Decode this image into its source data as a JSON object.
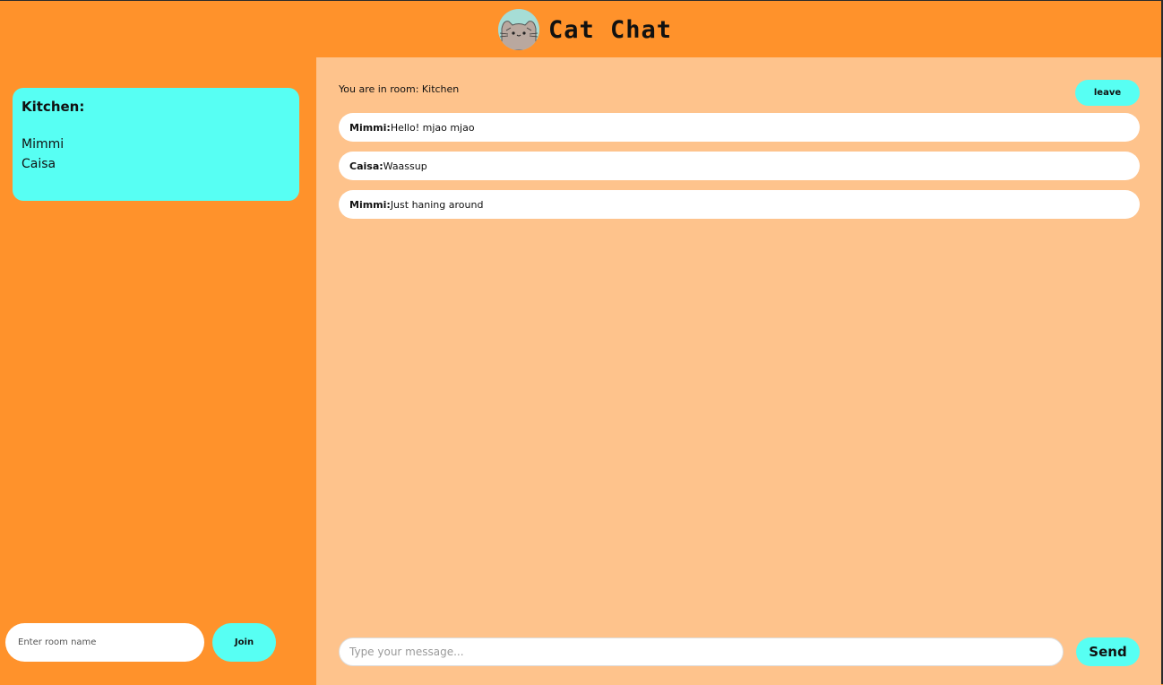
{
  "header": {
    "title": "Cat Chat",
    "logo_icon": "pusheen-cat-icon"
  },
  "sidebar": {
    "room": {
      "title": "Kitchen:",
      "members": [
        "Mimmi",
        "Caisa"
      ]
    },
    "join_form": {
      "placeholder": "Enter room name",
      "value": "",
      "join_label": "Join"
    }
  },
  "chat": {
    "room_status": "You are in room: Kitchen",
    "leave_label": "leave",
    "messages": [
      {
        "author": "Mimmi:",
        "text": "Hello! mjao mjao"
      },
      {
        "author": "Caisa:",
        "text": "Waassup"
      },
      {
        "author": "Mimmi:",
        "text": "Just haning around"
      }
    ],
    "compose": {
      "placeholder": "Type your message...",
      "value": "",
      "send_label": "Send"
    }
  },
  "colors": {
    "header_bg": "#ff922b",
    "sidebar_bg": "#ff922b",
    "panel_bg": "#fec38c",
    "accent": "#57fff3",
    "message_bg": "#ffffff"
  }
}
